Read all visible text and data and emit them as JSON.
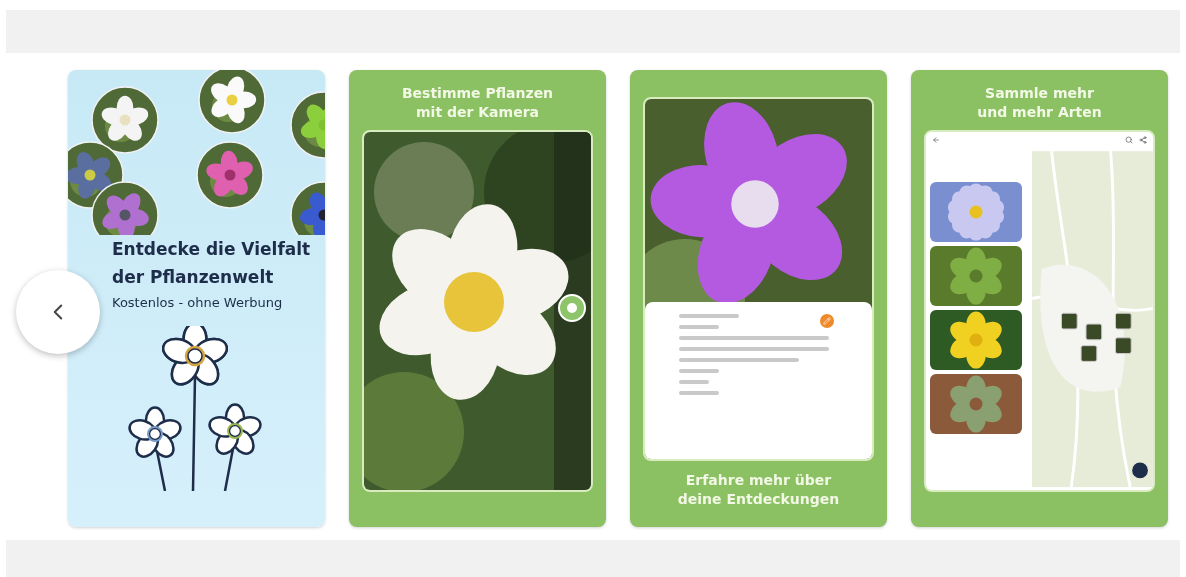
{
  "carousel": {
    "screenshots": [
      {
        "kind": "intro",
        "title": [
          "Entdecke die Vielfalt",
          "der Pflanzenwelt"
        ],
        "subtitle": "Kostenlos - ohne Werbung"
      },
      {
        "kind": "camera",
        "caption": [
          "Bestimme Pflanzen",
          "mit der Kamera"
        ]
      },
      {
        "kind": "details",
        "caption": [
          "Erfahre mehr über",
          "deine Entdeckungen"
        ]
      },
      {
        "kind": "collection",
        "caption": [
          "Sammle mehr",
          "und mehr Arten"
        ]
      }
    ]
  }
}
